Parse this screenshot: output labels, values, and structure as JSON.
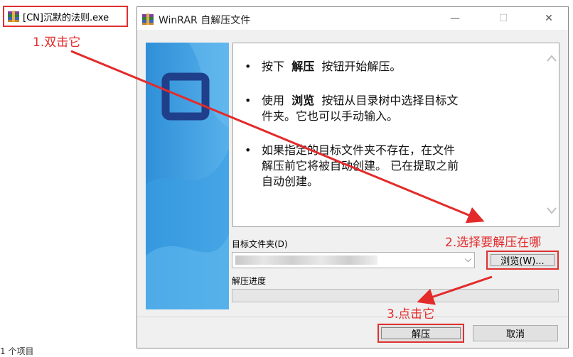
{
  "desktop": {
    "file_name": "[CN]沉默的法则.exe",
    "item_count": "1 个项目"
  },
  "annotations": {
    "step1": "1.双击它",
    "step2": "2.选择要解压在哪",
    "step3": "3.点击它",
    "color": "#e32b2b"
  },
  "window": {
    "title": "WinRAR 自解压文件",
    "controls": {
      "minimize": "—",
      "maximize": "☐",
      "close": "✕"
    },
    "info": {
      "b1_pre": "按下",
      "b1_bold": "解压",
      "b1_post": "按钮开始解压。",
      "b2_pre": "使用",
      "b2_bold": "浏览",
      "b2_post": "按钮从目录树中选择目标文",
      "b2_line2": "件夹。它也可以手动输入。",
      "b3_line1": "如果指定的目标文件夹不存在，在文件",
      "b3_line2": "解压前它将被自动创建。  已在提取之前",
      "b3_line3": "自动创建。"
    },
    "destination_label": "目标文件夹(D)",
    "destination_value": "",
    "browse_label": "浏览(W)...",
    "progress_label": "解压进度",
    "progress": 0,
    "extract_label": "解压",
    "cancel_label": "取消"
  }
}
